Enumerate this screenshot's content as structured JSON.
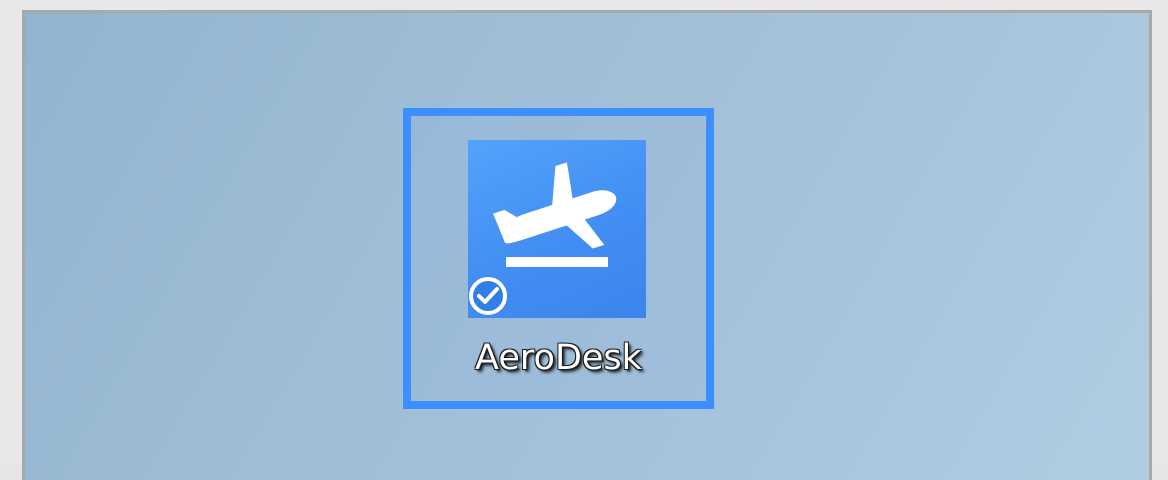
{
  "desktop": {
    "shortcut": {
      "label": "AeroDesk",
      "icon": "airplane-takeoff-icon",
      "badge_icon": "shortcut-check-badge-icon",
      "selected": true,
      "accent_color": "#3d8fff",
      "icon_background_color": "#4a94f5"
    }
  }
}
